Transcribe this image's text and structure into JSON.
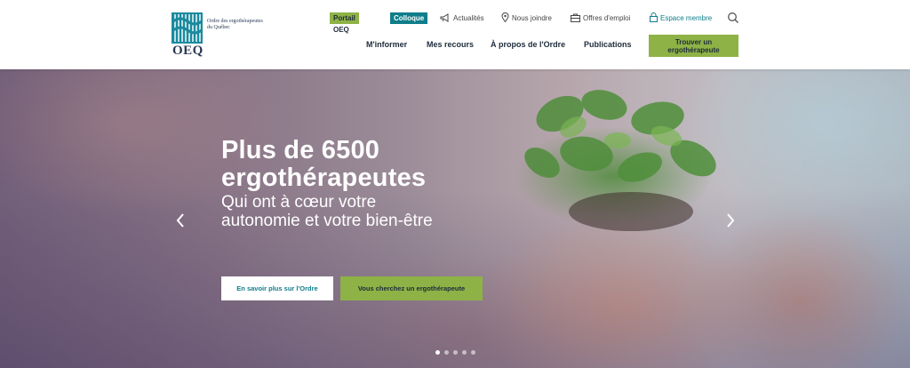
{
  "logo": {
    "tagline": "Ordre des ergothérapeutes du Québec",
    "acronym": "OEQ",
    "brand_color": "#1a8a9e"
  },
  "topbar": {
    "portail_label": "Portail OEQ",
    "colloque_label": "Colloque",
    "actualites_label": "Actualités",
    "joindre_label": "Nous joindre",
    "emploi_label": "Offres d'emploi",
    "membre_label": "Espace membre",
    "search_icon": "search-icon"
  },
  "nav": {
    "items": [
      "M'informer",
      "Mes recours",
      "À propos de l'Ordre",
      "Publications"
    ],
    "cta_label": "Trouver un ergothérapeute"
  },
  "hero": {
    "title": "Plus de 6500 ergothérapeutes",
    "subtitle": "Qui ont à cœur votre autonomie et votre bien-être",
    "primary_button": "En savoir plus sur l'Ordre",
    "secondary_button": "Vous cherchez un ergothérapeute",
    "slides_total": 5,
    "active_slide": 1
  },
  "colors": {
    "accent_green": "#8eb246",
    "accent_teal": "#0f7d8a",
    "text_dark": "#1d2b3a"
  }
}
